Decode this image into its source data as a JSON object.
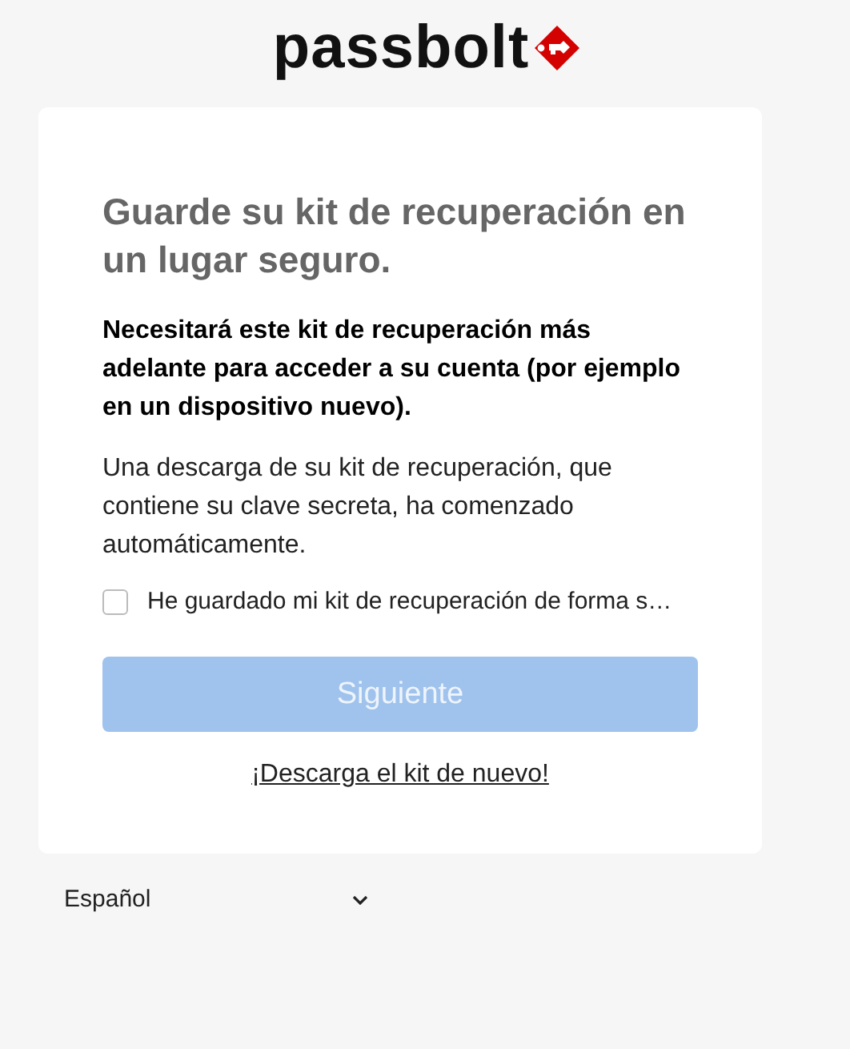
{
  "logo": {
    "text": "passbolt"
  },
  "card": {
    "title": "Guarde su kit de recuperación en un lugar seguro.",
    "warning": "Necesitará este kit de recuperación más adelante para acceder a su cuenta (por ejemplo en un dispositivo nuevo).",
    "info": "Una descarga de su kit de recuperación, que contiene su clave secreta, ha comenzado automáticamente.",
    "checkbox": {
      "label": "He guardado mi kit de recuperación de forma s…",
      "checked": false
    },
    "next_button": {
      "label": "Siguiente",
      "disabled": true
    },
    "download_link": "¡Descarga el kit de nuevo!"
  },
  "language": {
    "value": "Español"
  }
}
